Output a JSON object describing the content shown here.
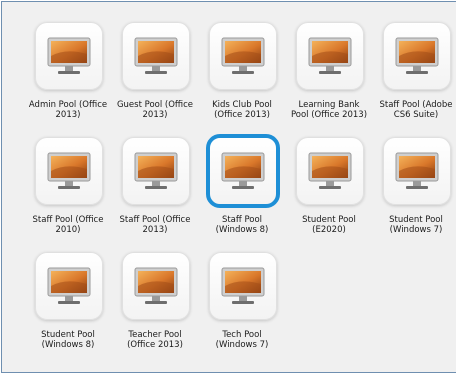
{
  "pools": [
    {
      "label": "Admin Pool (Office\n2013)",
      "icon": "desktop-icon",
      "selected": false
    },
    {
      "label": "Guest Pool (Office\n2013)",
      "icon": "desktop-icon",
      "selected": false
    },
    {
      "label": "Kids Club Pool\n(Office 2013)",
      "icon": "desktop-icon",
      "selected": false
    },
    {
      "label": "Learning Bank\nPool (Office 2013)",
      "icon": "desktop-icon",
      "selected": false
    },
    {
      "label": "Staff Pool (Adobe\nCS6 Suite)",
      "icon": "desktop-icon",
      "selected": false
    },
    {
      "label": "Staff Pool (Office\n2010)",
      "icon": "desktop-icon",
      "selected": false
    },
    {
      "label": "Staff Pool (Office\n2013)",
      "icon": "desktop-icon",
      "selected": false
    },
    {
      "label": "Staff Pool\n(Windows 8)",
      "icon": "desktop-icon",
      "selected": true
    },
    {
      "label": "Student Pool\n(E2020)",
      "icon": "desktop-icon",
      "selected": false
    },
    {
      "label": "Student Pool\n(Windows 7)",
      "icon": "desktop-icon",
      "selected": false
    },
    {
      "label": "Student Pool\n(Windows 8)",
      "icon": "desktop-icon",
      "selected": false
    },
    {
      "label": "Teacher Pool\n(Office 2013)",
      "icon": "desktop-icon",
      "selected": false
    },
    {
      "label": "Tech Pool\n(Windows 7)",
      "icon": "desktop-icon",
      "selected": false
    }
  ],
  "colors": {
    "selection_border": "#1e8fd6",
    "panel_background": "#f0f0f0",
    "frame_border": "#6f8fb0"
  }
}
